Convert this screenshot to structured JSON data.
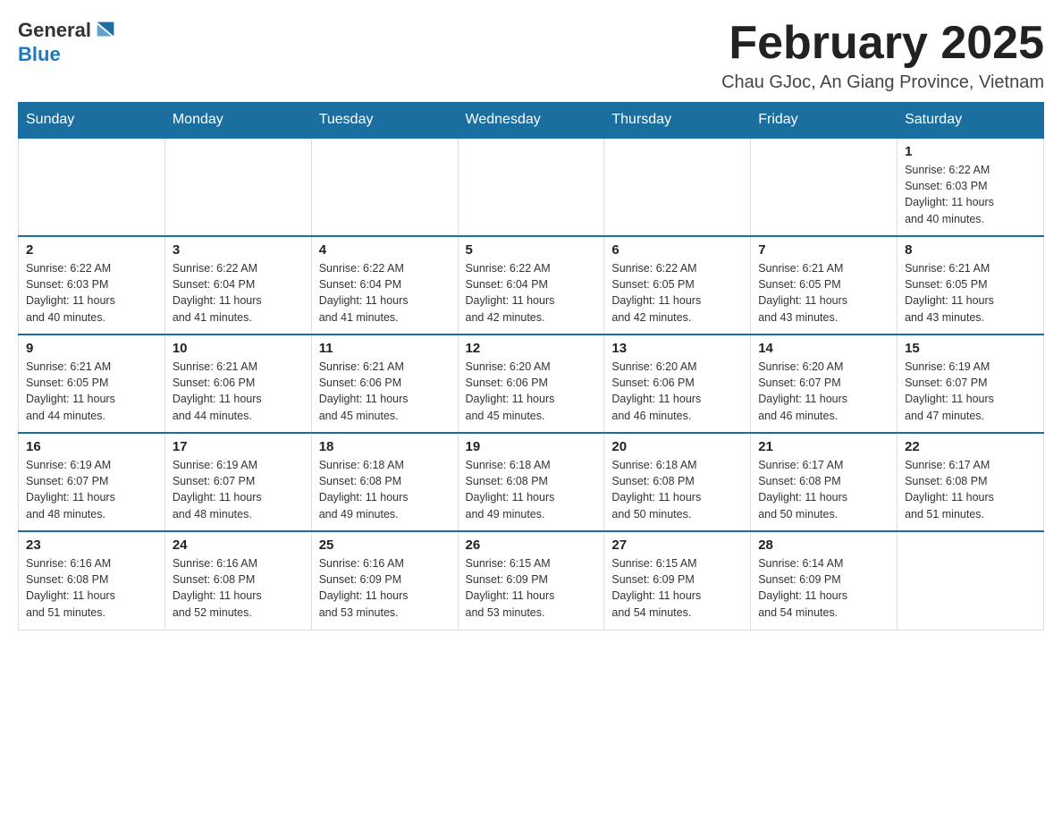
{
  "logo": {
    "general": "General",
    "blue": "Blue"
  },
  "title": "February 2025",
  "subtitle": "Chau GJoc, An Giang Province, Vietnam",
  "days_of_week": [
    "Sunday",
    "Monday",
    "Tuesday",
    "Wednesday",
    "Thursday",
    "Friday",
    "Saturday"
  ],
  "weeks": [
    [
      {
        "day": "",
        "info": ""
      },
      {
        "day": "",
        "info": ""
      },
      {
        "day": "",
        "info": ""
      },
      {
        "day": "",
        "info": ""
      },
      {
        "day": "",
        "info": ""
      },
      {
        "day": "",
        "info": ""
      },
      {
        "day": "1",
        "info": "Sunrise: 6:22 AM\nSunset: 6:03 PM\nDaylight: 11 hours\nand 40 minutes."
      }
    ],
    [
      {
        "day": "2",
        "info": "Sunrise: 6:22 AM\nSunset: 6:03 PM\nDaylight: 11 hours\nand 40 minutes."
      },
      {
        "day": "3",
        "info": "Sunrise: 6:22 AM\nSunset: 6:04 PM\nDaylight: 11 hours\nand 41 minutes."
      },
      {
        "day": "4",
        "info": "Sunrise: 6:22 AM\nSunset: 6:04 PM\nDaylight: 11 hours\nand 41 minutes."
      },
      {
        "day": "5",
        "info": "Sunrise: 6:22 AM\nSunset: 6:04 PM\nDaylight: 11 hours\nand 42 minutes."
      },
      {
        "day": "6",
        "info": "Sunrise: 6:22 AM\nSunset: 6:05 PM\nDaylight: 11 hours\nand 42 minutes."
      },
      {
        "day": "7",
        "info": "Sunrise: 6:21 AM\nSunset: 6:05 PM\nDaylight: 11 hours\nand 43 minutes."
      },
      {
        "day": "8",
        "info": "Sunrise: 6:21 AM\nSunset: 6:05 PM\nDaylight: 11 hours\nand 43 minutes."
      }
    ],
    [
      {
        "day": "9",
        "info": "Sunrise: 6:21 AM\nSunset: 6:05 PM\nDaylight: 11 hours\nand 44 minutes."
      },
      {
        "day": "10",
        "info": "Sunrise: 6:21 AM\nSunset: 6:06 PM\nDaylight: 11 hours\nand 44 minutes."
      },
      {
        "day": "11",
        "info": "Sunrise: 6:21 AM\nSunset: 6:06 PM\nDaylight: 11 hours\nand 45 minutes."
      },
      {
        "day": "12",
        "info": "Sunrise: 6:20 AM\nSunset: 6:06 PM\nDaylight: 11 hours\nand 45 minutes."
      },
      {
        "day": "13",
        "info": "Sunrise: 6:20 AM\nSunset: 6:06 PM\nDaylight: 11 hours\nand 46 minutes."
      },
      {
        "day": "14",
        "info": "Sunrise: 6:20 AM\nSunset: 6:07 PM\nDaylight: 11 hours\nand 46 minutes."
      },
      {
        "day": "15",
        "info": "Sunrise: 6:19 AM\nSunset: 6:07 PM\nDaylight: 11 hours\nand 47 minutes."
      }
    ],
    [
      {
        "day": "16",
        "info": "Sunrise: 6:19 AM\nSunset: 6:07 PM\nDaylight: 11 hours\nand 48 minutes."
      },
      {
        "day": "17",
        "info": "Sunrise: 6:19 AM\nSunset: 6:07 PM\nDaylight: 11 hours\nand 48 minutes."
      },
      {
        "day": "18",
        "info": "Sunrise: 6:18 AM\nSunset: 6:08 PM\nDaylight: 11 hours\nand 49 minutes."
      },
      {
        "day": "19",
        "info": "Sunrise: 6:18 AM\nSunset: 6:08 PM\nDaylight: 11 hours\nand 49 minutes."
      },
      {
        "day": "20",
        "info": "Sunrise: 6:18 AM\nSunset: 6:08 PM\nDaylight: 11 hours\nand 50 minutes."
      },
      {
        "day": "21",
        "info": "Sunrise: 6:17 AM\nSunset: 6:08 PM\nDaylight: 11 hours\nand 50 minutes."
      },
      {
        "day": "22",
        "info": "Sunrise: 6:17 AM\nSunset: 6:08 PM\nDaylight: 11 hours\nand 51 minutes."
      }
    ],
    [
      {
        "day": "23",
        "info": "Sunrise: 6:16 AM\nSunset: 6:08 PM\nDaylight: 11 hours\nand 51 minutes."
      },
      {
        "day": "24",
        "info": "Sunrise: 6:16 AM\nSunset: 6:08 PM\nDaylight: 11 hours\nand 52 minutes."
      },
      {
        "day": "25",
        "info": "Sunrise: 6:16 AM\nSunset: 6:09 PM\nDaylight: 11 hours\nand 53 minutes."
      },
      {
        "day": "26",
        "info": "Sunrise: 6:15 AM\nSunset: 6:09 PM\nDaylight: 11 hours\nand 53 minutes."
      },
      {
        "day": "27",
        "info": "Sunrise: 6:15 AM\nSunset: 6:09 PM\nDaylight: 11 hours\nand 54 minutes."
      },
      {
        "day": "28",
        "info": "Sunrise: 6:14 AM\nSunset: 6:09 PM\nDaylight: 11 hours\nand 54 minutes."
      },
      {
        "day": "",
        "info": ""
      }
    ]
  ]
}
